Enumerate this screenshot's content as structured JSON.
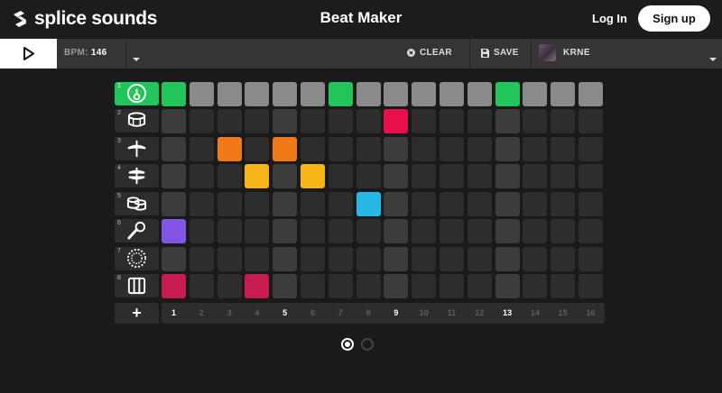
{
  "header": {
    "logo_text": "splice sounds",
    "title": "Beat Maker",
    "login_label": "Log In",
    "signup_label": "Sign up"
  },
  "toolbar": {
    "bpm_label": "BPM:",
    "bpm_value": "146",
    "clear_label": "CLEAR",
    "save_label": "SAVE",
    "kit_name": "KRNE"
  },
  "colors": {
    "green": "#22c55a",
    "red": "#e8104a",
    "orange": "#f07a17",
    "yellow": "#f7b519",
    "cyan": "#26b8e6",
    "purple": "#8257e6",
    "crimson": "#c81c50",
    "beat_cell": "#3c3c3c",
    "off_cell": "#2d2d2d",
    "playhead_on": "#8a8a8a"
  },
  "instruments": [
    {
      "number": "1",
      "icon": "kick-drum-icon",
      "selected": true
    },
    {
      "number": "2",
      "icon": "snare-drum-icon",
      "selected": false
    },
    {
      "number": "3",
      "icon": "cymbal-icon",
      "selected": false
    },
    {
      "number": "4",
      "icon": "hi-hat-icon",
      "selected": false
    },
    {
      "number": "5",
      "icon": "tom-drums-icon",
      "selected": false
    },
    {
      "number": "6",
      "icon": "microphone-icon",
      "selected": false
    },
    {
      "number": "7",
      "icon": "tambourine-icon",
      "selected": false
    },
    {
      "number": "8",
      "icon": "shaker-icon",
      "selected": false
    }
  ],
  "pattern": [
    [
      1,
      0,
      0,
      0,
      0,
      0,
      1,
      0,
      0,
      0,
      0,
      0,
      1,
      0,
      0,
      0
    ],
    [
      0,
      0,
      0,
      0,
      0,
      0,
      0,
      0,
      1,
      0,
      0,
      0,
      0,
      0,
      0,
      0
    ],
    [
      0,
      0,
      1,
      0,
      1,
      0,
      0,
      0,
      0,
      0,
      0,
      0,
      0,
      0,
      0,
      0
    ],
    [
      0,
      0,
      0,
      1,
      0,
      1,
      0,
      0,
      0,
      0,
      0,
      0,
      0,
      0,
      0,
      0
    ],
    [
      0,
      0,
      0,
      0,
      0,
      0,
      0,
      1,
      0,
      0,
      0,
      0,
      0,
      0,
      0,
      0
    ],
    [
      1,
      0,
      0,
      0,
      0,
      0,
      0,
      0,
      0,
      0,
      0,
      0,
      0,
      0,
      0,
      0
    ],
    [
      0,
      0,
      0,
      0,
      0,
      0,
      0,
      0,
      0,
      0,
      0,
      0,
      0,
      0,
      0,
      0
    ],
    [
      1,
      0,
      0,
      1,
      0,
      0,
      0,
      0,
      0,
      0,
      0,
      0,
      0,
      0,
      0,
      0
    ]
  ],
  "cell_colors": [
    [
      "green",
      "green",
      "green",
      "green",
      "green",
      "green",
      "green",
      "green",
      "green",
      "green",
      "green",
      "green",
      "green",
      "green",
      "green",
      "green"
    ],
    [
      "red",
      "red",
      "red",
      "red",
      "red",
      "red",
      "red",
      "red",
      "red",
      "red",
      "red",
      "red",
      "red",
      "red",
      "red",
      "red"
    ],
    [
      "orange",
      "orange",
      "orange",
      "orange",
      "orange",
      "orange",
      "orange",
      "orange",
      "orange",
      "orange",
      "orange",
      "orange",
      "orange",
      "orange",
      "orange",
      "orange"
    ],
    [
      "yellow",
      "yellow",
      "yellow",
      "yellow",
      "yellow",
      "yellow",
      "yellow",
      "yellow",
      "yellow",
      "yellow",
      "yellow",
      "yellow",
      "yellow",
      "yellow",
      "yellow",
      "yellow"
    ],
    [
      "cyan",
      "cyan",
      "cyan",
      "cyan",
      "cyan",
      "cyan",
      "cyan",
      "cyan",
      "cyan",
      "cyan",
      "cyan",
      "cyan",
      "cyan",
      "cyan",
      "cyan",
      "cyan"
    ],
    [
      "purple",
      "purple",
      "purple",
      "purple",
      "purple",
      "purple",
      "purple",
      "purple",
      "purple",
      "purple",
      "purple",
      "purple",
      "purple",
      "purple",
      "purple",
      "purple"
    ],
    [
      "green",
      "green",
      "green",
      "green",
      "green",
      "green",
      "green",
      "green",
      "green",
      "green",
      "green",
      "green",
      "green",
      "green",
      "green",
      "green"
    ],
    [
      "crimson",
      "crimson",
      "crimson",
      "crimson",
      "crimson",
      "crimson",
      "crimson",
      "crimson",
      "crimson",
      "crimson",
      "crimson",
      "crimson",
      "crimson",
      "crimson",
      "crimson",
      "crimson"
    ]
  ],
  "steps": [
    "1",
    "2",
    "3",
    "4",
    "5",
    "6",
    "7",
    "8",
    "9",
    "10",
    "11",
    "12",
    "13",
    "14",
    "15",
    "16"
  ],
  "beat_steps": [
    1,
    5,
    9,
    13
  ],
  "pages": {
    "count": 2,
    "current": 1
  }
}
